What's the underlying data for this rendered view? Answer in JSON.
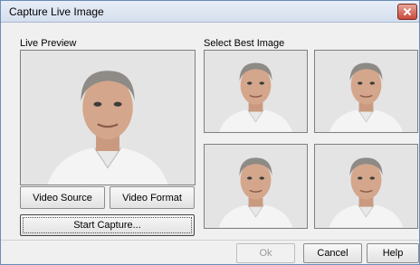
{
  "window": {
    "title": "Capture Live Image"
  },
  "preview": {
    "label": "Live Preview"
  },
  "best": {
    "label": "Select Best Image"
  },
  "buttons": {
    "video_source": "Video Source",
    "video_format": "Video Format",
    "start_capture": "Start Capture...",
    "ok": "Ok",
    "cancel": "Cancel",
    "help": "Help"
  },
  "colors": {
    "title_border": "#6b8cb8",
    "close": "#c8493a",
    "dialog_bg": "#f0f0f0"
  }
}
